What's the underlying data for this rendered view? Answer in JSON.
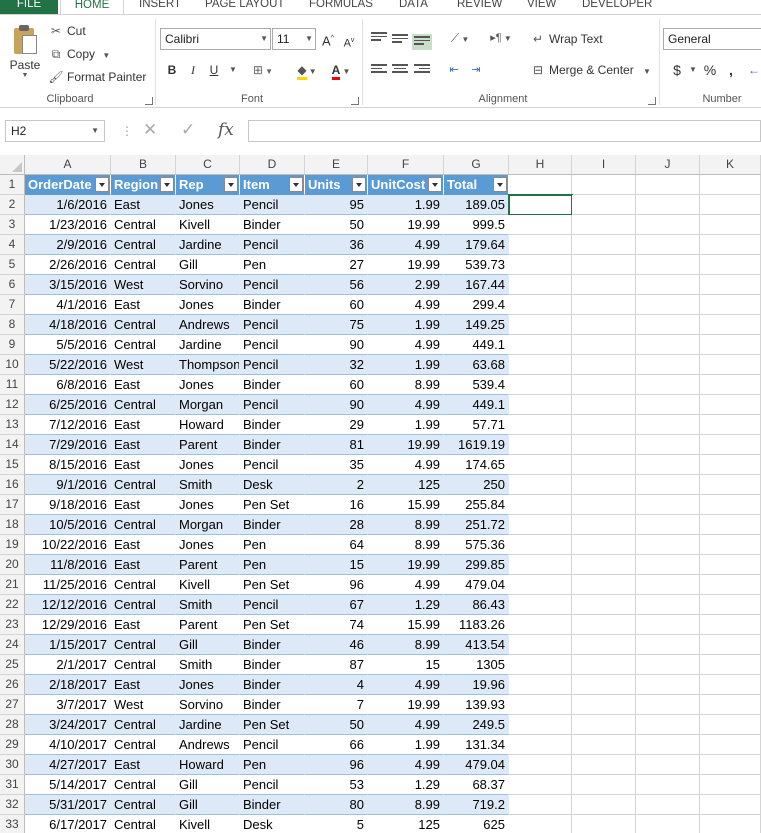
{
  "ribbon": {
    "tabs": [
      "FILE",
      "HOME",
      "INSERT",
      "PAGE LAYOUT",
      "FORMULAS",
      "DATA",
      "REVIEW",
      "VIEW",
      "DEVELOPER"
    ],
    "clipboard": {
      "paste": "Paste",
      "cut": "Cut",
      "copy": "Copy",
      "format_painter": "Format Painter",
      "group": "Clipboard"
    },
    "font": {
      "name": "Calibri",
      "size": "11",
      "bold": "B",
      "italic": "I",
      "underline": "U",
      "grow": "A",
      "shrink": "A",
      "group": "Font"
    },
    "alignment": {
      "wrap_text": "Wrap Text",
      "merge_center": "Merge & Center",
      "group": "Alignment"
    },
    "number": {
      "format": "General",
      "currency": "$",
      "percent": "%",
      "comma": ",",
      "group": "Number"
    }
  },
  "formula_bar": {
    "name_box": "H2",
    "fx": "fx",
    "formula": ""
  },
  "sheet": {
    "columns": [
      "A",
      "B",
      "C",
      "D",
      "E",
      "F",
      "G",
      "H",
      "I",
      "J",
      "K"
    ],
    "headers": [
      "OrderDate",
      "Region",
      "Rep",
      "Item",
      "Units",
      "UnitCost",
      "Total"
    ],
    "rows": [
      [
        "1/6/2016",
        "East",
        "Jones",
        "Pencil",
        "95",
        "1.99",
        "189.05"
      ],
      [
        "1/23/2016",
        "Central",
        "Kivell",
        "Binder",
        "50",
        "19.99",
        "999.5"
      ],
      [
        "2/9/2016",
        "Central",
        "Jardine",
        "Pencil",
        "36",
        "4.99",
        "179.64"
      ],
      [
        "2/26/2016",
        "Central",
        "Gill",
        "Pen",
        "27",
        "19.99",
        "539.73"
      ],
      [
        "3/15/2016",
        "West",
        "Sorvino",
        "Pencil",
        "56",
        "2.99",
        "167.44"
      ],
      [
        "4/1/2016",
        "East",
        "Jones",
        "Binder",
        "60",
        "4.99",
        "299.4"
      ],
      [
        "4/18/2016",
        "Central",
        "Andrews",
        "Pencil",
        "75",
        "1.99",
        "149.25"
      ],
      [
        "5/5/2016",
        "Central",
        "Jardine",
        "Pencil",
        "90",
        "4.99",
        "449.1"
      ],
      [
        "5/22/2016",
        "West",
        "Thompson",
        "Pencil",
        "32",
        "1.99",
        "63.68"
      ],
      [
        "6/8/2016",
        "East",
        "Jones",
        "Binder",
        "60",
        "8.99",
        "539.4"
      ],
      [
        "6/25/2016",
        "Central",
        "Morgan",
        "Pencil",
        "90",
        "4.99",
        "449.1"
      ],
      [
        "7/12/2016",
        "East",
        "Howard",
        "Binder",
        "29",
        "1.99",
        "57.71"
      ],
      [
        "7/29/2016",
        "East",
        "Parent",
        "Binder",
        "81",
        "19.99",
        "1619.19"
      ],
      [
        "8/15/2016",
        "East",
        "Jones",
        "Pencil",
        "35",
        "4.99",
        "174.65"
      ],
      [
        "9/1/2016",
        "Central",
        "Smith",
        "Desk",
        "2",
        "125",
        "250"
      ],
      [
        "9/18/2016",
        "East",
        "Jones",
        "Pen Set",
        "16",
        "15.99",
        "255.84"
      ],
      [
        "10/5/2016",
        "Central",
        "Morgan",
        "Binder",
        "28",
        "8.99",
        "251.72"
      ],
      [
        "10/22/2016",
        "East",
        "Jones",
        "Pen",
        "64",
        "8.99",
        "575.36"
      ],
      [
        "11/8/2016",
        "East",
        "Parent",
        "Pen",
        "15",
        "19.99",
        "299.85"
      ],
      [
        "11/25/2016",
        "Central",
        "Kivell",
        "Pen Set",
        "96",
        "4.99",
        "479.04"
      ],
      [
        "12/12/2016",
        "Central",
        "Smith",
        "Pencil",
        "67",
        "1.29",
        "86.43"
      ],
      [
        "12/29/2016",
        "East",
        "Parent",
        "Pen Set",
        "74",
        "15.99",
        "1183.26"
      ],
      [
        "1/15/2017",
        "Central",
        "Gill",
        "Binder",
        "46",
        "8.99",
        "413.54"
      ],
      [
        "2/1/2017",
        "Central",
        "Smith",
        "Binder",
        "87",
        "15",
        "1305"
      ],
      [
        "2/18/2017",
        "East",
        "Jones",
        "Binder",
        "4",
        "4.99",
        "19.96"
      ],
      [
        "3/7/2017",
        "West",
        "Sorvino",
        "Binder",
        "7",
        "19.99",
        "139.93"
      ],
      [
        "3/24/2017",
        "Central",
        "Jardine",
        "Pen Set",
        "50",
        "4.99",
        "249.5"
      ],
      [
        "4/10/2017",
        "Central",
        "Andrews",
        "Pencil",
        "66",
        "1.99",
        "131.34"
      ],
      [
        "4/27/2017",
        "East",
        "Howard",
        "Pen",
        "96",
        "4.99",
        "479.04"
      ],
      [
        "5/14/2017",
        "Central",
        "Gill",
        "Pencil",
        "53",
        "1.29",
        "68.37"
      ],
      [
        "5/31/2017",
        "Central",
        "Gill",
        "Binder",
        "80",
        "8.99",
        "719.2"
      ],
      [
        "6/17/2017",
        "Central",
        "Kivell",
        "Desk",
        "5",
        "125",
        "625"
      ]
    ],
    "header_color": "#5b9bd5",
    "band_color": "#dde9f6",
    "accent_color": "#217346"
  }
}
